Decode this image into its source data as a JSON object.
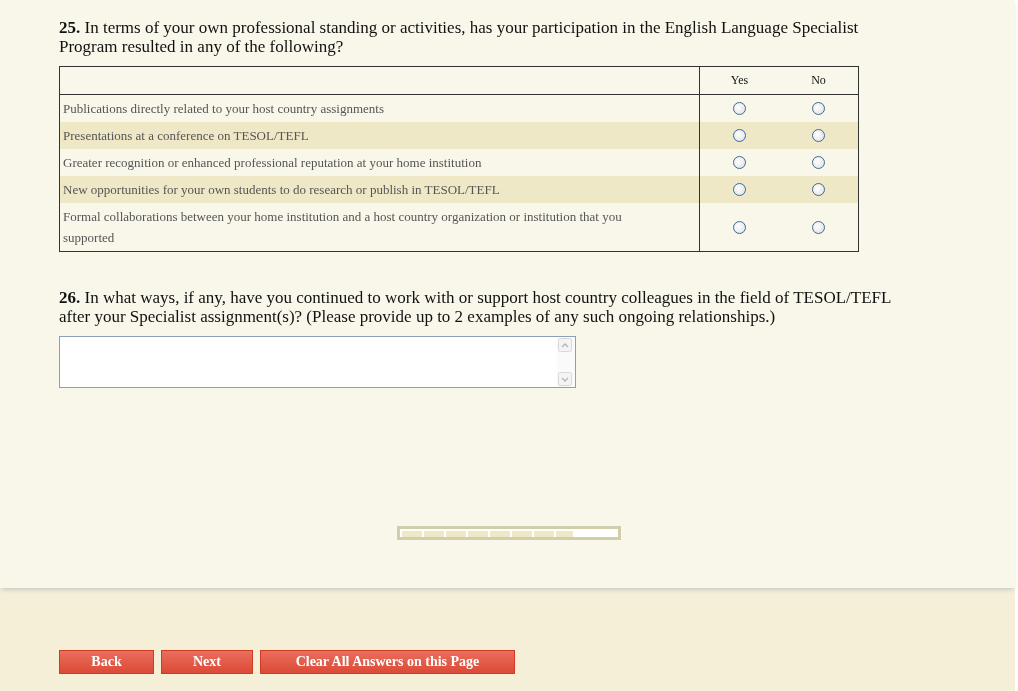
{
  "questions": [
    {
      "kind": "matrix",
      "text": "**25.** In terms of your own professional standing or activities, has your participation in the English Language Specialist Program resulted in any of the following?",
      "columns": [
        "Yes",
        "No"
      ],
      "rows": [
        {
          "label": "Publications directly related to your host country assignments",
          "answers": [
            {
              "selected": false
            },
            {
              "selected": false
            }
          ]
        },
        {
          "label": "Presentations at a conference on TESOL/TEFL",
          "answers": [
            {
              "selected": false
            },
            {
              "selected": false
            }
          ]
        },
        {
          "label": "Greater recognition or enhanced professional reputation at your home institution",
          "answers": [
            {
              "selected": false
            },
            {
              "selected": false
            }
          ]
        },
        {
          "label": "New opportunities for your own students to do research or publish in TESOL/TEFL",
          "answers": [
            {
              "selected": false
            },
            {
              "selected": false
            }
          ]
        },
        {
          "label": "Formal collaborations between your home institution and a host country organization or institution that you supported",
          "answers": [
            {
              "selected": false
            },
            {
              "selected": false
            }
          ]
        }
      ]
    },
    {
      "kind": "text",
      "text": "**26.** In what ways, if any, have you continued to work with or support host country colleagues in the field of TESOL/TEFL after your Specialist assignment(s)? (Please provide up to 2 examples of any such ongoing relationships.)"
    }
  ],
  "progress": {
    "level": 0.8
  },
  "buttons": [
    "Back",
    "Next",
    "Clear All Answers on this Page"
  ]
}
